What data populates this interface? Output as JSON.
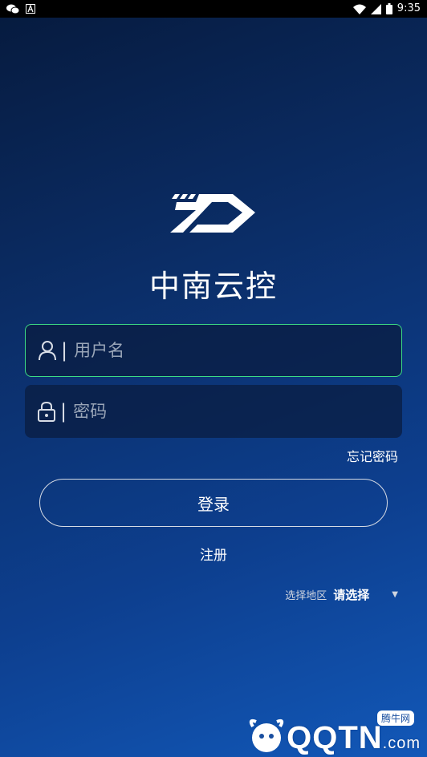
{
  "status_bar": {
    "time": "9:35",
    "icons": [
      "chat-icon",
      "a-notification-icon",
      "wifi-icon",
      "signal-icon",
      "battery-icon"
    ]
  },
  "app": {
    "title": "中南云控",
    "logo_icon": "zd-logo-icon"
  },
  "form": {
    "username": {
      "placeholder": "用户名",
      "value": "",
      "icon": "user-icon"
    },
    "password": {
      "placeholder": "密码",
      "value": "",
      "icon": "lock-icon"
    },
    "separator": "|",
    "forgot_label": "忘记密码",
    "login_label": "登录",
    "register_label": "注册"
  },
  "region": {
    "label": "选择地区",
    "selected": "请选择",
    "arrow": "▼"
  },
  "watermark": {
    "text": "QQTN",
    "suffix": ".com",
    "badge": "腾牛网"
  },
  "colors": {
    "background_top": "#061a3d",
    "background_bottom": "#1258b8",
    "active_border": "#3ddc84",
    "field_bg": "#0a1c3e"
  }
}
